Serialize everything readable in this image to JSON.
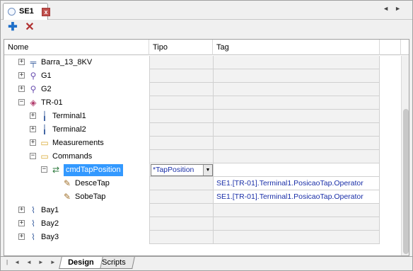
{
  "tab": {
    "title": "SE1",
    "close": "x"
  },
  "toolbar": {
    "add_icon": "plus-icon",
    "delete_icon": "delete-x-icon"
  },
  "columns": {
    "nome": "Nome",
    "tipo": "Tipo",
    "tag": "Tag"
  },
  "tree": [
    {
      "label": "Barra_13_8KV",
      "icon": "busbar-icon",
      "expander": "+",
      "tipo": "",
      "tag": ""
    },
    {
      "label": "G1",
      "icon": "generator-icon",
      "expander": "+",
      "tipo": "",
      "tag": ""
    },
    {
      "label": "G2",
      "icon": "generator-icon",
      "expander": "+",
      "tipo": "",
      "tag": ""
    },
    {
      "label": "TR-01",
      "icon": "transformer-icon",
      "expander": "−",
      "tipo": "",
      "tag": ""
    },
    {
      "label": "Terminal1",
      "icon": "terminal-icon",
      "expander": "+",
      "tipo": "",
      "tag": ""
    },
    {
      "label": "Terminal2",
      "icon": "terminal-icon",
      "expander": "+",
      "tipo": "",
      "tag": ""
    },
    {
      "label": "Measurements",
      "icon": "folder-icon",
      "expander": "+",
      "tipo": "",
      "tag": ""
    },
    {
      "label": "Commands",
      "icon": "folder-open-icon",
      "expander": "−",
      "tipo": "",
      "tag": ""
    },
    {
      "label": "cmdTapPosition",
      "icon": "command-icon",
      "expander": "−",
      "tipo": "*TapPosition",
      "tag": ""
    },
    {
      "label": "DesceTap",
      "icon": "command-item-icon",
      "expander": "",
      "tipo": "",
      "tag": "SE1.[TR-01].Terminal1.PosicaoTap.Operator"
    },
    {
      "label": "SobeTap",
      "icon": "command-item-icon",
      "expander": "",
      "tipo": "",
      "tag": "SE1.[TR-01].Terminal1.PosicaoTap.Operator"
    },
    {
      "label": "Bay1",
      "icon": "bay-icon",
      "expander": "+",
      "tipo": "",
      "tag": ""
    },
    {
      "label": "Bay2",
      "icon": "bay-icon",
      "expander": "+",
      "tipo": "",
      "tag": ""
    },
    {
      "label": "Bay3",
      "icon": "bay-icon",
      "expander": "+",
      "tipo": "",
      "tag": ""
    }
  ],
  "sheet_tabs": [
    "Design",
    "Scripts"
  ],
  "colors": {
    "selection": "#3399ff",
    "tag_text": "#1a2fa8"
  }
}
